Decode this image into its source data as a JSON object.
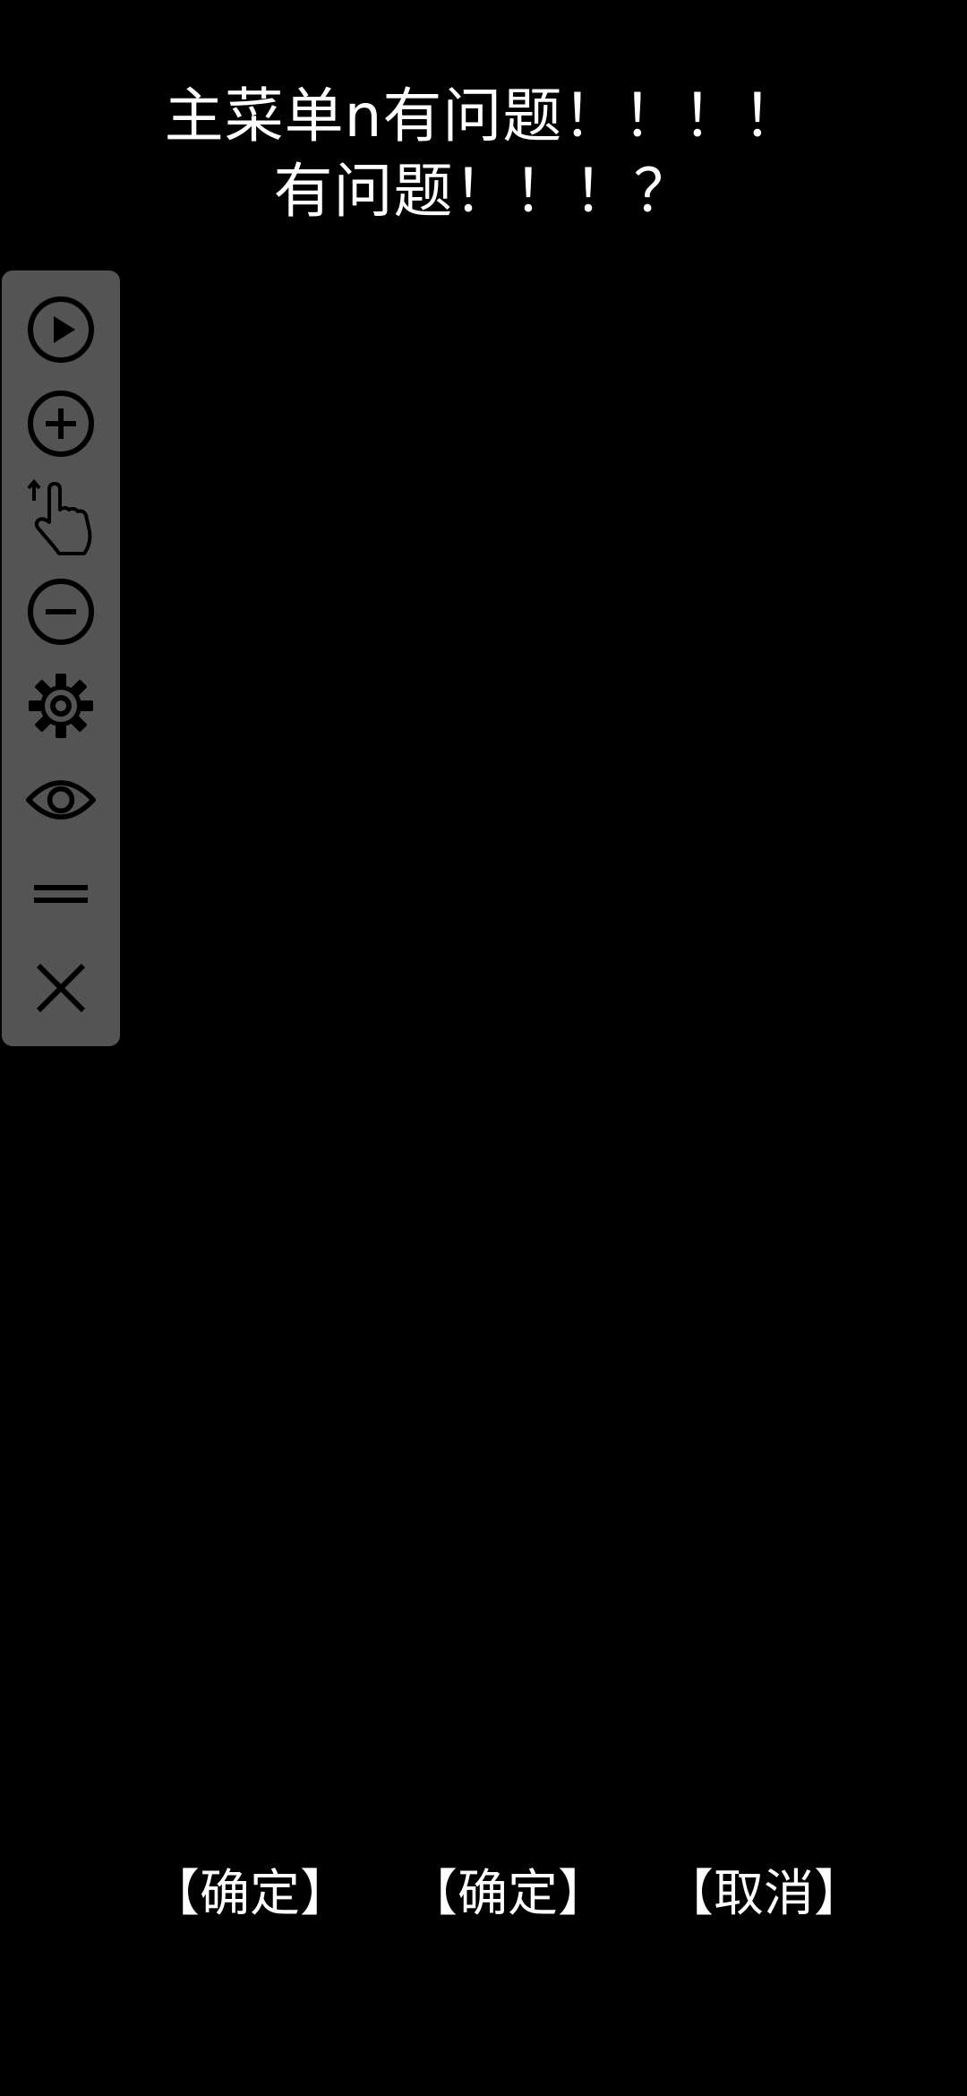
{
  "message": {
    "line1": "主菜单n有问题！！！！",
    "line2": "有问题！！！？"
  },
  "toolbar": {
    "icons": [
      "play-circle-icon",
      "plus-circle-icon",
      "swipe-up-hand-icon",
      "minus-circle-icon",
      "gear-icon",
      "eye-icon",
      "drag-handle-icon",
      "close-icon"
    ],
    "panel_color": "#545454",
    "icon_color": "#000000"
  },
  "actions": {
    "confirm_1": "【确定】",
    "confirm_2": "【确定】",
    "cancel": "【取消】"
  }
}
